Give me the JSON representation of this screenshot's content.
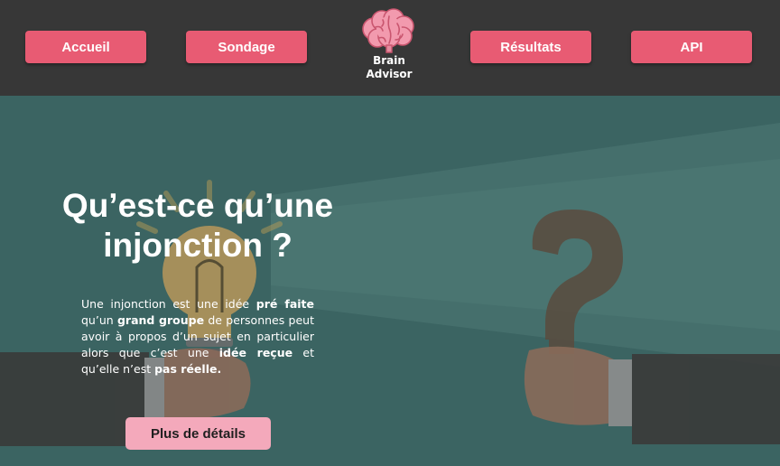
{
  "nav": {
    "items": [
      {
        "label": "Accueil"
      },
      {
        "label": "Sondage"
      },
      {
        "label": "Résultats"
      },
      {
        "label": "API"
      }
    ]
  },
  "logo": {
    "line1": "Brain",
    "line2": "Advisor",
    "icon": "brain-icon"
  },
  "hero": {
    "title": "Qu’est-ce qu’une injonction ?",
    "description": {
      "p1": "Une injonction est une idée ",
      "b1": "pré faite",
      "p2": " qu’un ",
      "b2": "grand groupe",
      "p3": " de personnes peut avoir à propos d’un sujet en particulier alors que c’est une ",
      "b3": "idée reçue",
      "p4": " et qu’elle n’est ",
      "b4": "pas réelle."
    },
    "button_label": "Plus de détails"
  },
  "colors": {
    "header_bg": "#373737",
    "accent": "#e85b73",
    "hero_bg": "#3b6462",
    "button_light": "#f4a9bb"
  }
}
